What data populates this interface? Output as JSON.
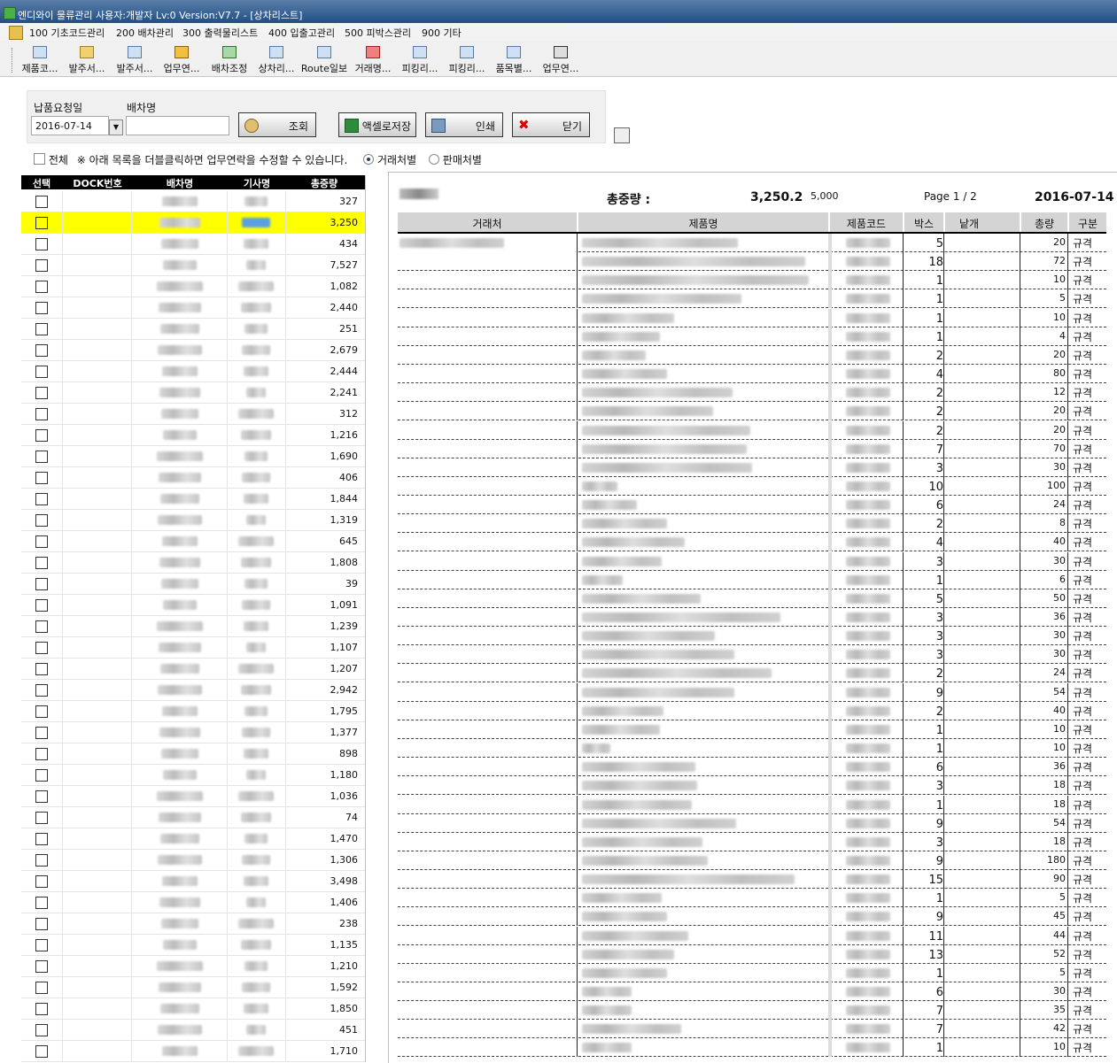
{
  "window": {
    "title": "엔디와이 물류관리 사용자:개발자 Lv:0  Version:V7.7 - [상차리스트]"
  },
  "menu": {
    "items": [
      "100 기초코드관리",
      "200 배차관리",
      "300 출력물리스트",
      "400 입출고관리",
      "500 피박스관리",
      "900 기타"
    ]
  },
  "toolbar": {
    "buttons": [
      {
        "label": "제품코..."
      },
      {
        "label": "발주서..."
      },
      {
        "label": "발주서..."
      },
      {
        "label": "업무연..."
      },
      {
        "label": "배차조정"
      },
      {
        "label": "상차리..."
      },
      {
        "label": "Route일보"
      },
      {
        "label": "거래명..."
      },
      {
        "label": "피킹리..."
      },
      {
        "label": "피킹리..."
      },
      {
        "label": "품목별..."
      },
      {
        "label": "업무연..."
      }
    ]
  },
  "filter": {
    "date_label": "납품요청일",
    "date_value": "2016-07-14",
    "vehicle_label": "배차명",
    "vehicle_value": "",
    "search_label": "조회",
    "excel_label": "액셀로저장",
    "print_label": "인쇄",
    "close_label": "닫기"
  },
  "options": {
    "all_label": "전체",
    "notice": "※ 아래 목록을 더블클릭하면 업무연락을 수정할 수 있습니다.",
    "radio1": "거래처별",
    "radio2": "판매처별",
    "selected": "거래처별"
  },
  "left_grid": {
    "headers": [
      "선택",
      "DOCK번호",
      "배차명",
      "기사명",
      "총중량"
    ],
    "selected_index": 1,
    "highlight_color": "#ffff00",
    "rows": [
      "327",
      "3,250",
      "434",
      "7,527",
      "1,082",
      "2,440",
      "251",
      "2,679",
      "2,444",
      "2,241",
      "312",
      "1,216",
      "1,690",
      "406",
      "1,844",
      "1,319",
      "645",
      "1,808",
      "39",
      "1,091",
      "1,239",
      "1,107",
      "1,207",
      "2,942",
      "1,795",
      "1,377",
      "898",
      "1,180",
      "1,036",
      "74",
      "1,470",
      "1,306",
      "3,498",
      "1,406",
      "238",
      "1,135",
      "1,210",
      "1,592",
      "1,850",
      "451",
      "1,710"
    ]
  },
  "report": {
    "weight_label": "총중량 :",
    "weight_value": "3,250.2",
    "capacity": "5,000",
    "page": "Page 1 / 2",
    "date": "2016-07-14",
    "columns": [
      "거래처",
      "제품명",
      "제품코드",
      "박스",
      "낱개",
      "총량",
      "구분"
    ],
    "rows": [
      {
        "box": "5",
        "total": "20",
        "type": "규격"
      },
      {
        "box": "18",
        "total": "72",
        "type": "규격"
      },
      {
        "box": "1",
        "total": "10",
        "type": "규격"
      },
      {
        "box": "1",
        "total": "5",
        "type": "규격"
      },
      {
        "box": "1",
        "total": "10",
        "type": "규격"
      },
      {
        "box": "1",
        "total": "4",
        "type": "규격"
      },
      {
        "box": "2",
        "total": "20",
        "type": "규격"
      },
      {
        "box": "4",
        "total": "80",
        "type": "규격"
      },
      {
        "box": "2",
        "total": "12",
        "type": "규격"
      },
      {
        "box": "2",
        "total": "20",
        "type": "규격"
      },
      {
        "box": "2",
        "total": "20",
        "type": "규격"
      },
      {
        "box": "7",
        "total": "70",
        "type": "규격"
      },
      {
        "box": "3",
        "total": "30",
        "type": "규격"
      },
      {
        "box": "10",
        "total": "100",
        "type": "규격"
      },
      {
        "box": "6",
        "total": "24",
        "type": "규격"
      },
      {
        "box": "2",
        "total": "8",
        "type": "규격"
      },
      {
        "box": "4",
        "total": "40",
        "type": "규격"
      },
      {
        "box": "3",
        "total": "30",
        "type": "규격"
      },
      {
        "box": "1",
        "total": "6",
        "type": "규격"
      },
      {
        "box": "5",
        "total": "50",
        "type": "규격"
      },
      {
        "box": "3",
        "total": "36",
        "type": "규격"
      },
      {
        "box": "3",
        "total": "30",
        "type": "규격"
      },
      {
        "box": "3",
        "total": "30",
        "type": "규격"
      },
      {
        "box": "2",
        "total": "24",
        "type": "규격"
      },
      {
        "box": "9",
        "total": "54",
        "type": "규격"
      },
      {
        "box": "2",
        "total": "40",
        "type": "규격"
      },
      {
        "box": "1",
        "total": "10",
        "type": "규격"
      },
      {
        "box": "1",
        "total": "10",
        "type": "규격"
      },
      {
        "box": "6",
        "total": "36",
        "type": "규격"
      },
      {
        "box": "3",
        "total": "18",
        "type": "규격"
      },
      {
        "box": "1",
        "total": "18",
        "type": "규격"
      },
      {
        "box": "9",
        "total": "54",
        "type": "규격"
      },
      {
        "box": "3",
        "total": "18",
        "type": "규격"
      },
      {
        "box": "9",
        "total": "180",
        "type": "규격"
      },
      {
        "box": "15",
        "total": "90",
        "type": "규격"
      },
      {
        "box": "1",
        "total": "5",
        "type": "규격"
      },
      {
        "box": "9",
        "total": "45",
        "type": "규격"
      },
      {
        "box": "11",
        "total": "44",
        "type": "규격"
      },
      {
        "box": "13",
        "total": "52",
        "type": "규격"
      },
      {
        "box": "1",
        "total": "5",
        "type": "규격"
      },
      {
        "box": "6",
        "total": "30",
        "type": "규격"
      },
      {
        "box": "7",
        "total": "35",
        "type": "규격"
      },
      {
        "box": "7",
        "total": "42",
        "type": "규격"
      },
      {
        "box": "1",
        "total": "10",
        "type": "규격"
      }
    ]
  }
}
